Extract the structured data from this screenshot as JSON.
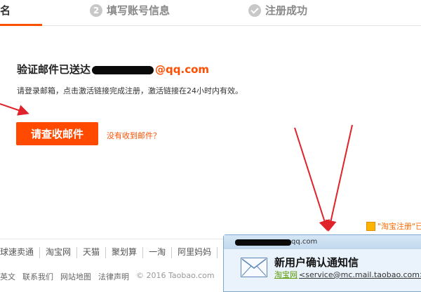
{
  "steps": {
    "step1_label": "名",
    "step2_num": "2",
    "step2_label": "填写账号信息",
    "step3_label": "注册成功"
  },
  "verify": {
    "prefix": "验证邮件已送达",
    "domain": "@qq.com",
    "instruction": "请登录邮箱，点击激活链接完成注册，激活链接在24小时内有效。"
  },
  "actions": {
    "check_mail": "请查收邮件",
    "no_mail": "没有收到邮件？"
  },
  "footer": {
    "links": [
      "球速卖通",
      "淘宝网",
      "天猫",
      "聚划算",
      "一淘",
      "阿里妈妈",
      "阿"
    ],
    "bottom_links": [
      "英文",
      "联系我们",
      "网站地图",
      "法律声明"
    ],
    "copyright": "© 2016 Taobao.com"
  },
  "taobao_reg": "\"淘宝注册\"已",
  "popup": {
    "addr_suffix": "qq.com",
    "title": "新用户确认通知信",
    "sender_name": "淘宝网",
    "sender_email": "<service@mc.mail.taobao.com>"
  },
  "colors": {
    "accent": "#ff5000",
    "annotation": "#e0222a"
  }
}
